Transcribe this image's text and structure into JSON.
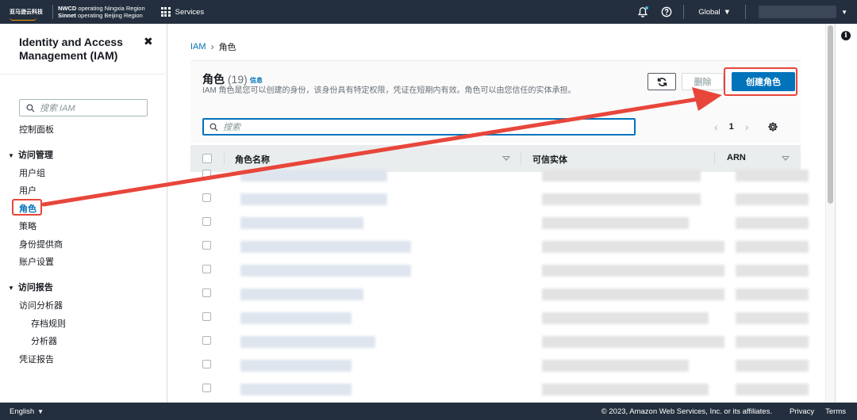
{
  "topnav": {
    "logo_text": "亚马逊云科技",
    "region_line1_bold": "NWCD",
    "region_line1": "operating Ningxia Region",
    "region_line2_bold": "Sinnet",
    "region_line2": "operating Beijing Region",
    "services_label": "Services",
    "global_label": "Global",
    "icons": [
      "services-grid-icon",
      "bell-icon",
      "help-circle-icon",
      "chevron-down-icon"
    ],
    "notification_dot_color": "#44b9d6"
  },
  "sidebar": {
    "title": "Identity and Access Management (IAM)",
    "close_glyph": "✖",
    "search_placeholder": "搜索 IAM",
    "dashboard": "控制面板",
    "sections": [
      {
        "label": "访问管理",
        "items": [
          "用户组",
          "用户",
          "角色",
          "策略",
          "身份提供商",
          "账户设置"
        ]
      },
      {
        "label": "访问报告",
        "items": [
          "访问分析器",
          "存档规则",
          "分析器",
          "凭证报告"
        ]
      }
    ],
    "active_item": "角色"
  },
  "breadcrumb": {
    "root": "IAM",
    "current": "角色"
  },
  "roles_panel": {
    "title": "角色",
    "count": "(19)",
    "info_link": "信息",
    "description": "IAM 角色是您可以创建的身份，该身份具有特定权限，凭证在短期内有效。角色可以由您信任的实体承担。",
    "delete_button": "删除",
    "create_button": "创建角色",
    "search_placeholder": "搜索",
    "page_number": "1",
    "columns": [
      "角色名称",
      "可信实体",
      "ARN"
    ],
    "visible_row_count": 10
  },
  "footer": {
    "language": "English",
    "copyright": "© 2023, Amazon Web Services, Inc. or its affiliates.",
    "privacy": "Privacy",
    "terms": "Terms"
  },
  "colors": {
    "nav_bg": "#232f3e",
    "accent_link": "#0073bb",
    "primary_button": "#0073bb",
    "annotation_red": "#e8463b",
    "brand_orange": "#ff9900"
  }
}
